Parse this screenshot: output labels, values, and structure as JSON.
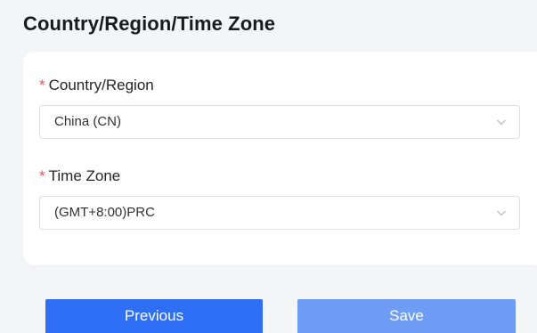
{
  "page": {
    "title": "Country/Region/Time Zone"
  },
  "form": {
    "required_mark": "*",
    "country": {
      "label": "Country/Region",
      "value": "China (CN)"
    },
    "timezone": {
      "label": "Time Zone",
      "value": "(GMT+8:00)PRC"
    }
  },
  "actions": {
    "previous_label": "Previous",
    "save_label": "Save"
  },
  "colors": {
    "required": "#ff4d4f",
    "primary": "#2f6ff5",
    "primary_disabled": "#6f9cf4",
    "background": "#f4f5f7"
  },
  "icons": {
    "select_arrow": "chevron-down-icon"
  }
}
